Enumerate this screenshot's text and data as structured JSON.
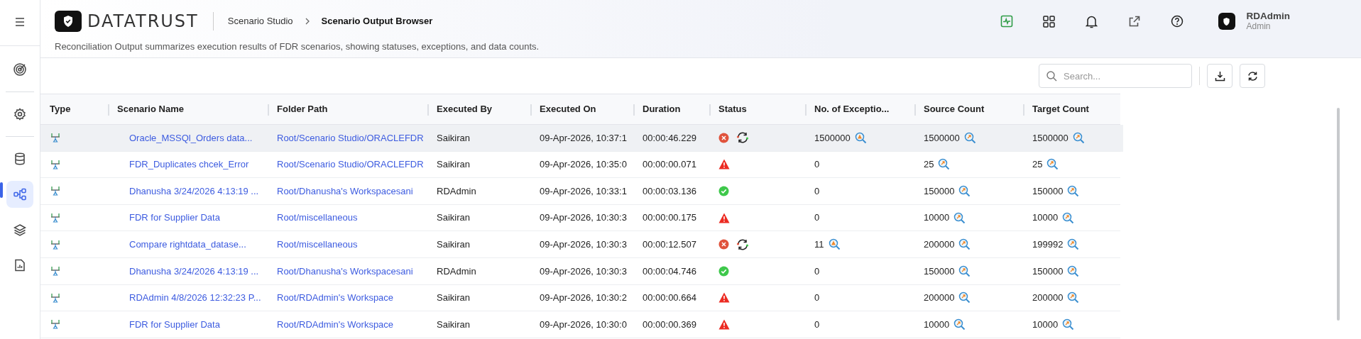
{
  "header": {
    "logo_text": "DATATRUST",
    "breadcrumb": [
      {
        "label": "Scenario Studio",
        "current": false
      },
      {
        "label": "Scenario Output Browser",
        "current": true
      }
    ],
    "description": "Reconciliation Output summarizes execution results of FDR scenarios, showing statuses, exceptions, and data counts.",
    "user": {
      "name": "RDAdmin",
      "role": "Admin"
    }
  },
  "sidebar": {
    "items": [
      {
        "kind": "menu",
        "selected": false
      },
      {
        "kind": "target",
        "selected": false
      },
      {
        "kind": "settings",
        "selected": false
      },
      {
        "kind": "database",
        "selected": false
      },
      {
        "kind": "diagram",
        "selected": true
      },
      {
        "kind": "layers",
        "selected": false
      },
      {
        "kind": "report",
        "selected": false
      }
    ]
  },
  "toolbar": {
    "search": {
      "placeholder": "Search..."
    }
  },
  "table": {
    "columns": [
      "Type",
      "Scenario Name",
      "Folder Path",
      "Executed By",
      "Executed On",
      "Duration",
      "Status",
      "No. of Exceptio...",
      "Source Count",
      "Target Count"
    ],
    "rows": [
      {
        "selected": true,
        "scenario": "Oracle_MSSQl_Orders data...",
        "folder": "Root/Scenario Studio/ORACLEFDR",
        "by": "Saikiran",
        "on": "09-Apr-2026, 10:37:1",
        "duration": "00:00:46.229",
        "status": {
          "kind": "error"
        },
        "rerun": true,
        "exceptions": "1500000",
        "exception_alert": true,
        "source": "1500000",
        "target": "1500000"
      },
      {
        "selected": false,
        "scenario": "FDR_Duplicates chcek_Error",
        "folder": "Root/Scenario Studio/ORACLEFDR",
        "by": "Saikiran",
        "on": "09-Apr-2026, 10:35:0",
        "duration": "00:00:00.071",
        "status": {
          "kind": "warning"
        },
        "rerun": false,
        "exceptions": "0",
        "exception_alert": false,
        "source": "25",
        "target": "25"
      },
      {
        "selected": false,
        "scenario": "Dhanusha 3/24/2026 4:13:19 ...",
        "folder": "Root/Dhanusha's Workspacesani",
        "by": "RDAdmin",
        "on": "09-Apr-2026, 10:33:1",
        "duration": "00:00:03.136",
        "status": {
          "kind": "success"
        },
        "rerun": false,
        "exceptions": "0",
        "exception_alert": false,
        "source": "150000",
        "target": "150000"
      },
      {
        "selected": false,
        "scenario": "FDR for Supplier Data",
        "folder": "Root/miscellaneous",
        "by": "Saikiran",
        "on": "09-Apr-2026, 10:30:3",
        "duration": "00:00:00.175",
        "status": {
          "kind": "warning"
        },
        "rerun": false,
        "exceptions": "0",
        "exception_alert": false,
        "source": "10000",
        "target": "10000"
      },
      {
        "selected": false,
        "scenario": "Compare rightdata_datase...",
        "folder": "Root/miscellaneous",
        "by": "Saikiran",
        "on": "09-Apr-2026, 10:30:3",
        "duration": "00:00:12.507",
        "status": {
          "kind": "error"
        },
        "rerun": true,
        "exceptions": "11",
        "exception_alert": true,
        "source": "200000",
        "target": "199992"
      },
      {
        "selected": false,
        "scenario": "Dhanusha 3/24/2026 4:13:19 ...",
        "folder": "Root/Dhanusha's Workspacesani",
        "by": "RDAdmin",
        "on": "09-Apr-2026, 10:30:3",
        "duration": "00:00:04.746",
        "status": {
          "kind": "success"
        },
        "rerun": false,
        "exceptions": "0",
        "exception_alert": false,
        "source": "150000",
        "target": "150000"
      },
      {
        "selected": false,
        "scenario": "RDAdmin 4/8/2026 12:32:23 P...",
        "folder": "Root/RDAdmin's Workspace",
        "by": "Saikiran",
        "on": "09-Apr-2026, 10:30:2",
        "duration": "00:00:00.664",
        "status": {
          "kind": "warning"
        },
        "rerun": false,
        "exceptions": "0",
        "exception_alert": false,
        "source": "200000",
        "target": "200000"
      },
      {
        "selected": false,
        "scenario": "FDR for Supplier Data",
        "folder": "Root/RDAdmin's Workspace",
        "by": "Saikiran",
        "on": "09-Apr-2026, 10:30:0",
        "duration": "00:00:00.369",
        "status": {
          "kind": "warning"
        },
        "rerun": false,
        "exceptions": "0",
        "exception_alert": false,
        "source": "10000",
        "target": "10000"
      }
    ]
  }
}
